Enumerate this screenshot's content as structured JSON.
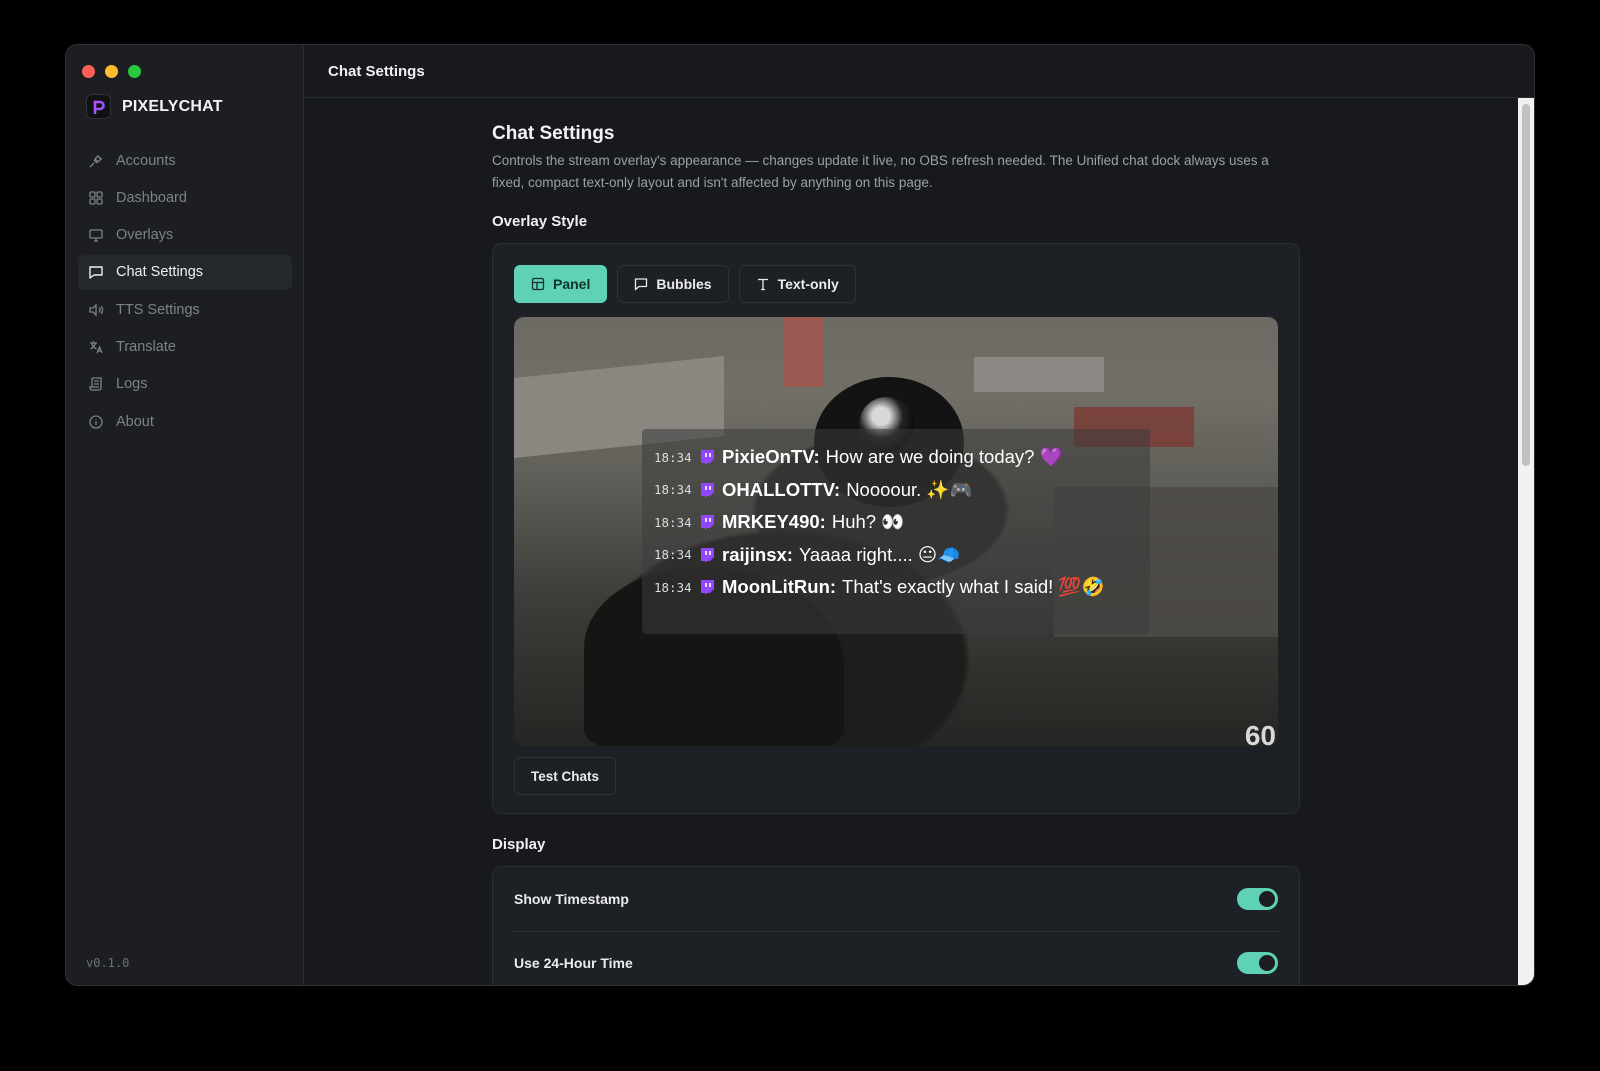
{
  "app": {
    "name": "PIXELYCHAT",
    "version": "v0.1.0"
  },
  "topbar": {
    "title": "Chat Settings"
  },
  "sidebar": {
    "items": [
      {
        "label": "Accounts",
        "icon": "plug-icon",
        "active": false
      },
      {
        "label": "Dashboard",
        "icon": "grid-icon",
        "active": false
      },
      {
        "label": "Overlays",
        "icon": "monitor-icon",
        "active": false
      },
      {
        "label": "Chat Settings",
        "icon": "message-icon",
        "active": true
      },
      {
        "label": "TTS Settings",
        "icon": "speaker-icon",
        "active": false
      },
      {
        "label": "Translate",
        "icon": "translate-icon",
        "active": false
      },
      {
        "label": "Logs",
        "icon": "scroll-icon",
        "active": false
      },
      {
        "label": "About",
        "icon": "info-icon",
        "active": false
      }
    ]
  },
  "page": {
    "title": "Chat Settings",
    "description": "Controls the stream overlay's appearance — changes update it live, no OBS refresh needed. The Unified chat dock always uses a fixed, compact text-only layout and isn't affected by anything on this page."
  },
  "overlay_style": {
    "heading": "Overlay Style",
    "tabs": [
      {
        "label": "Panel",
        "icon": "layout-icon",
        "active": true
      },
      {
        "label": "Bubbles",
        "icon": "bubble-icon",
        "active": false
      },
      {
        "label": "Text-only",
        "icon": "text-icon",
        "active": false
      }
    ],
    "preview": {
      "corner_text": "60",
      "messages": [
        {
          "time": "18:34",
          "user": "PixieOnTV:",
          "text": "How are we doing today? 💜"
        },
        {
          "time": "18:34",
          "user": "OHALLOTTV:",
          "text": "Noooour. ✨🎮"
        },
        {
          "time": "18:34",
          "user": "MRKEY490:",
          "text": "Huh? 👀"
        },
        {
          "time": "18:34",
          "user": "raijinsx:",
          "text": "Yaaaa right.... 😐🧢"
        },
        {
          "time": "18:34",
          "user": "MoonLitRun:",
          "text": "That's exactly what I said! 💯🤣"
        }
      ]
    },
    "test_button": "Test Chats"
  },
  "display": {
    "heading": "Display",
    "settings": [
      {
        "label": "Show Timestamp",
        "enabled": true
      },
      {
        "label": "Use 24-Hour Time",
        "enabled": true
      }
    ]
  },
  "colors": {
    "accent": "#5fd1b5",
    "background": "#17191c",
    "sidebar": "#1c1e22",
    "twitch": "#9146ff"
  }
}
